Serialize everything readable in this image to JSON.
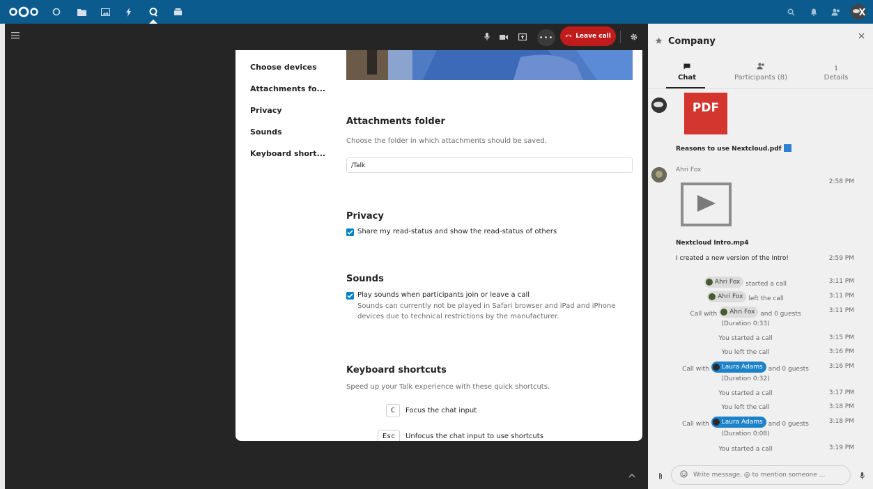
{
  "top_nav": {
    "apps": [
      {
        "name": "dashboard",
        "icon": "circle-icon",
        "glyph": "○"
      },
      {
        "name": "files",
        "icon": "folder-icon",
        "glyph": "■"
      },
      {
        "name": "photos",
        "icon": "image-icon",
        "glyph": "▣"
      },
      {
        "name": "activity",
        "icon": "bolt-icon",
        "glyph": "ϟ"
      },
      {
        "name": "talk",
        "icon": "talk-icon",
        "glyph": "Q"
      },
      {
        "name": "deck",
        "icon": "deck-icon",
        "glyph": "▬"
      }
    ],
    "active_app": "talk"
  },
  "call_controls": {
    "leave_label": "Leave call"
  },
  "settings_modal": {
    "nav": [
      "Choose devices",
      "Attachments fo...",
      "Privacy",
      "Sounds",
      "Keyboard short..."
    ],
    "attachments": {
      "heading": "Attachments folder",
      "description": "Choose the folder in which attachments should be saved.",
      "folder_value": "/Talk"
    },
    "privacy": {
      "heading": "Privacy",
      "read_status_label": "Share my read-status and show the read-status of others",
      "read_status_checked": true
    },
    "sounds": {
      "heading": "Sounds",
      "play_sounds_label": "Play sounds when participants join or leave a call",
      "play_sounds_checked": true,
      "hint": "Sounds can currently not be played in Safari browser and iPad and iPhone devices due to technical restrictions by the manufacturer."
    },
    "shortcuts": {
      "heading": "Keyboard shortcuts",
      "description": "Speed up your Talk experience with these quick shortcuts.",
      "items": [
        {
          "key": "C",
          "action": "Focus the chat input"
        },
        {
          "key": "Esc",
          "action": "Unfocus the chat input to use shortcuts"
        }
      ]
    }
  },
  "sidebar": {
    "title": "Company",
    "tabs": [
      {
        "label": "Chat",
        "icon": "chat-icon",
        "active": true
      },
      {
        "label": "Participants (8)",
        "icon": "participants-icon",
        "active": false
      },
      {
        "label": "Details",
        "icon": "info-icon",
        "active": false
      }
    ],
    "messages": {
      "pdf_label": "PDF",
      "pdf_name": "Reasons to use Nextcloud.pdf",
      "author": "Ahri Fox",
      "author_time": "2:58 PM",
      "video_name": "Nextcloud Intro.mp4",
      "text": "I created a new version of the Intro!",
      "text_time": "2:59 PM"
    },
    "system_messages": {
      "m1": {
        "pre": "",
        "mention": "Ahri Fox",
        "post": "started a call",
        "sub": "",
        "time": "3:11 PM"
      },
      "m2": {
        "pre": "",
        "mention": "Ahri Fox",
        "post": "left the call",
        "sub": "",
        "time": "3:11 PM"
      },
      "m3": {
        "pre": "Call with",
        "mention": "Ahri Fox",
        "post": "and 0 guests",
        "sub": "(Duration 0:33)",
        "time": "3:11 PM"
      },
      "m4": {
        "text": "You started a call",
        "time": "3:15 PM"
      },
      "m5": {
        "text": "You left the call",
        "time": "3:16 PM"
      },
      "m6": {
        "pre": "Call with",
        "mention": "Laura Adams",
        "post": "and 0 guests",
        "sub": "(Duration 0:32)",
        "time": "3:16 PM"
      },
      "m7": {
        "text": "You started a call",
        "time": "3:17 PM"
      },
      "m8": {
        "text": "You left the call",
        "time": "3:18 PM"
      },
      "m9": {
        "pre": "Call with",
        "mention": "Laura Adams",
        "post": "and 0 guests",
        "sub": "(Duration 0:08)",
        "time": "3:18 PM"
      },
      "m10": {
        "text": "You started a call",
        "time": "3:19 PM"
      }
    },
    "composer_placeholder": "Write message, @ to mention someone ..."
  }
}
